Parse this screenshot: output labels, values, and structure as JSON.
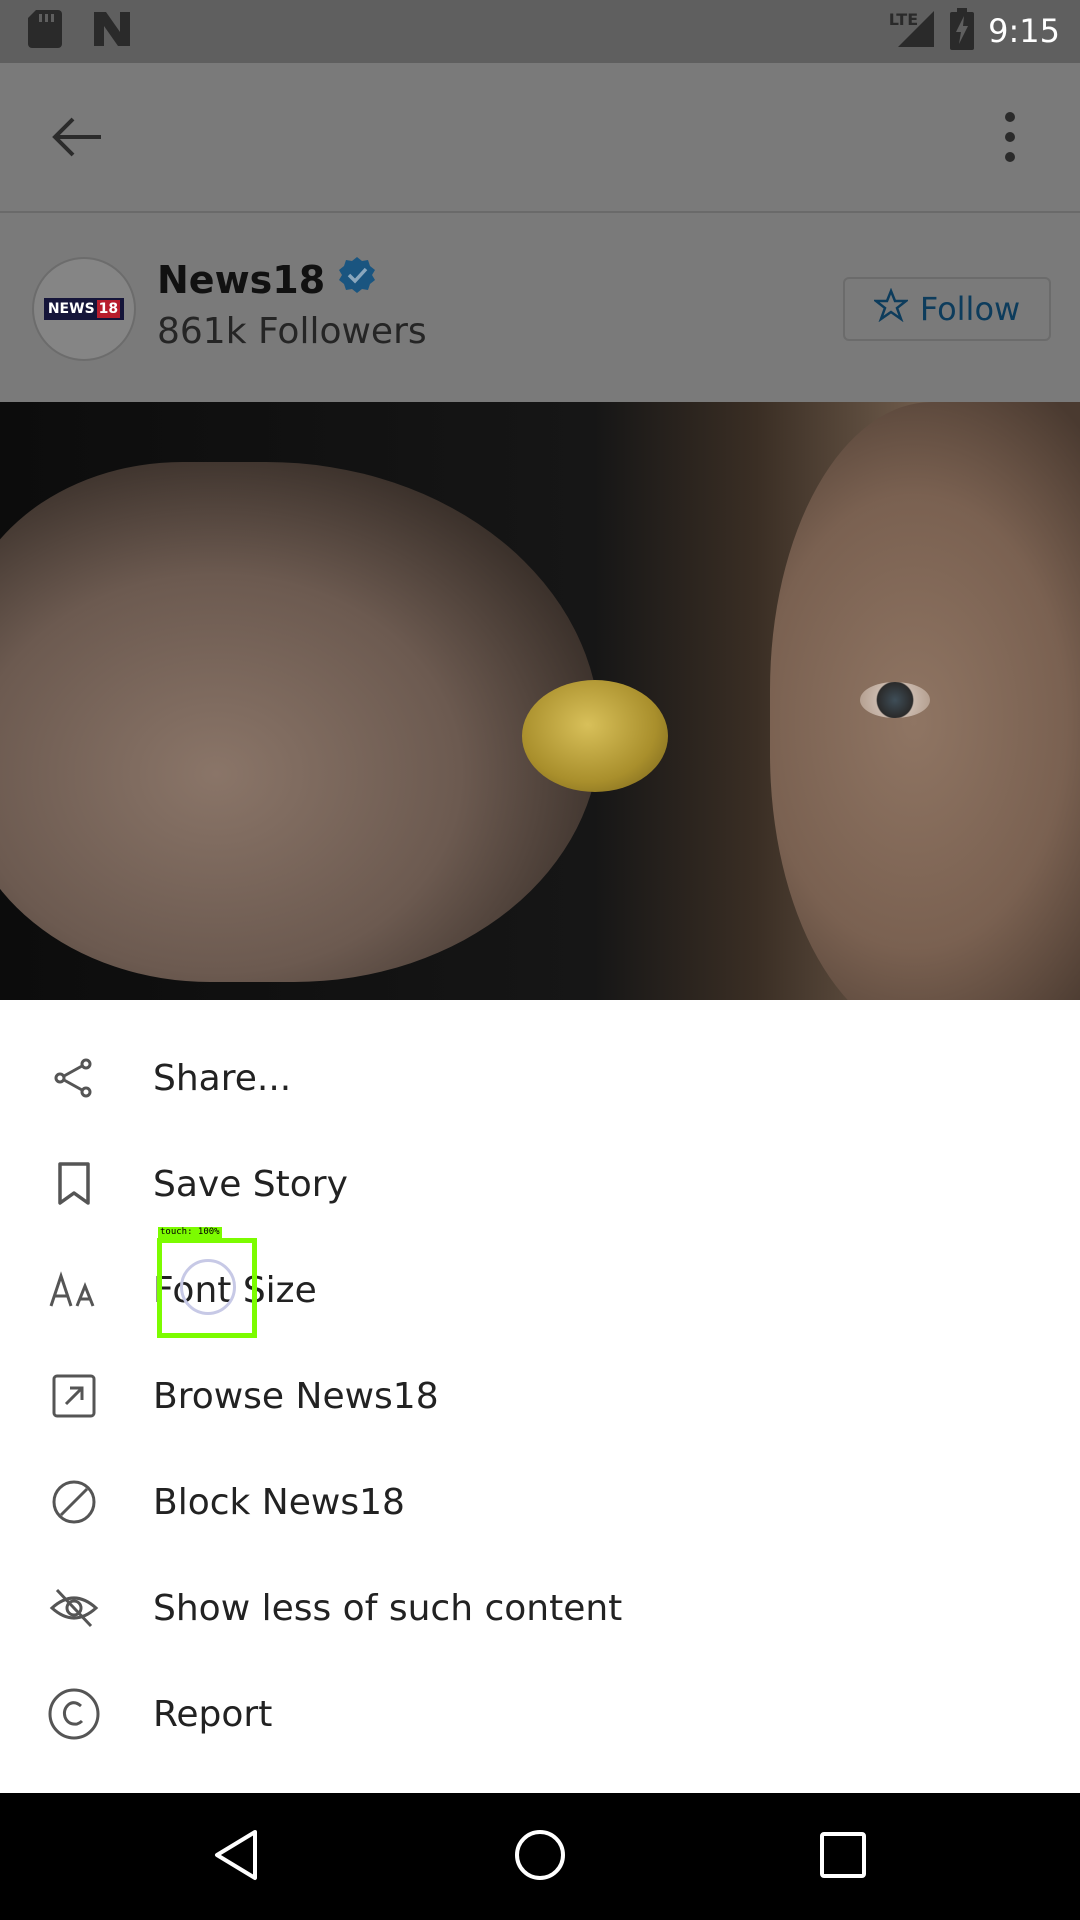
{
  "status_bar": {
    "time": "9:15",
    "network_label": "LTE",
    "icons": [
      "sd-card-icon",
      "n-notification-icon",
      "signal-icon",
      "battery-charging-icon"
    ]
  },
  "app_bar": {
    "back_icon": "arrow-back-icon",
    "more_icon": "more-vert-icon"
  },
  "publisher": {
    "logo_text": "NEWS",
    "logo_number": "18",
    "name": "News18",
    "verified_icon": "verified-badge-icon",
    "followers": "861k Followers",
    "follow_label": "Follow",
    "follow_icon": "star-outline-icon"
  },
  "menu": {
    "items": [
      {
        "label": "Share...",
        "icon": "share-icon"
      },
      {
        "label": "Save Story",
        "icon": "bookmark-icon"
      },
      {
        "label": "Font Size",
        "icon": "font-size-icon"
      },
      {
        "label": "Browse News18",
        "icon": "open-external-icon"
      },
      {
        "label": "Block News18",
        "icon": "block-icon"
      },
      {
        "label": "Show less of such content",
        "icon": "eye-off-icon"
      },
      {
        "label": "Report",
        "icon": "copyright-icon"
      }
    ]
  },
  "touch_indicator": {
    "label": "touch: 100%"
  },
  "nav_bar": {
    "icons": [
      "nav-back-icon",
      "nav-home-icon",
      "nav-recents-icon"
    ]
  },
  "colors": {
    "follow_accent": "#0d3c5c",
    "verified_badge": "#1a6aa0",
    "touch_box": "#7cfc00",
    "dim_overlay_bg": "#7a7a7a"
  }
}
